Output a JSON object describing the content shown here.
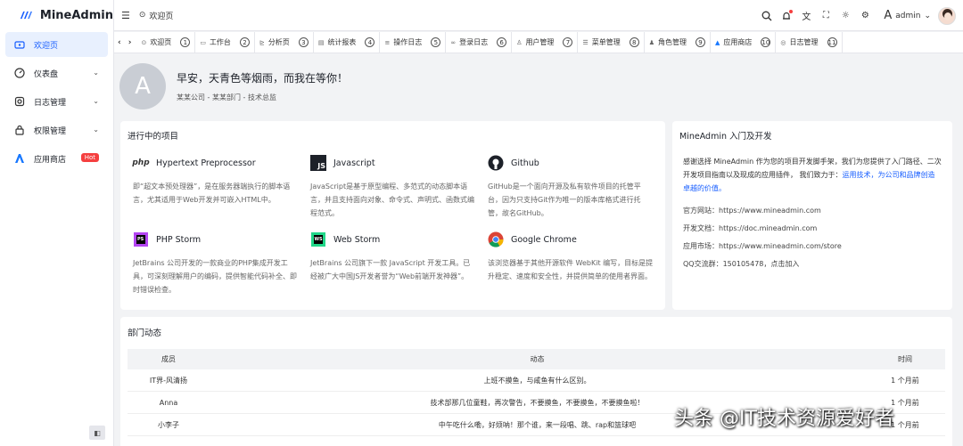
{
  "app": {
    "name": "MineAdmin"
  },
  "sidebar": {
    "items": [
      {
        "label": "欢迎页",
        "active": true
      },
      {
        "label": "仪表盘"
      },
      {
        "label": "日志管理"
      },
      {
        "label": "权限管理"
      },
      {
        "label": "应用商店",
        "badge": "Hot"
      }
    ]
  },
  "header": {
    "breadcrumb": "欢迎页",
    "username": "admin",
    "avatar_letter": "A"
  },
  "tabs": [
    {
      "label": "欢迎页",
      "num": "1"
    },
    {
      "label": "工作台",
      "num": "2"
    },
    {
      "label": "分析页",
      "num": "3"
    },
    {
      "label": "统计报表",
      "num": "4"
    },
    {
      "label": "操作日志",
      "num": "5"
    },
    {
      "label": "登录日志",
      "num": "6"
    },
    {
      "label": "用户管理",
      "num": "7"
    },
    {
      "label": "菜单管理",
      "num": "8"
    },
    {
      "label": "角色管理",
      "num": "9"
    },
    {
      "label": "应用商店",
      "num": "10"
    },
    {
      "label": "日志管理",
      "num": "11"
    }
  ],
  "welcome": {
    "avatar_letter": "A",
    "greeting": "早安，天青色等烟雨，而我在等你！",
    "subtitle": "某某公司 - 某某部门 - 技术总监"
  },
  "projects": {
    "title": "进行中的项目",
    "items": [
      {
        "name": "Hypertext Preprocessor",
        "logo": "php",
        "desc": "即“超文本预处理器”，是在服务器端执行的脚本语言，尤其适用于Web开发并可嵌入HTML中。"
      },
      {
        "name": "Javascript",
        "logo": "JS",
        "desc": "JavaScript是基于原型编程、多范式的动态脚本语言，并且支持面向对象、命令式、声明式、函数式编程范式。"
      },
      {
        "name": "Github",
        "logo": "github",
        "desc": "GitHub是一个面向开源及私有软件项目的托管平台，因为只支持Git作为唯一的版本库格式进行托管，故名GitHub。"
      },
      {
        "name": "PHP Storm",
        "logo": "PS",
        "desc": "JetBrains 公司开发的一款商业的PHP集成开发工具，可深刻理解用户的编码，提供智能代码补全、即时错误检查。"
      },
      {
        "name": "Web Storm",
        "logo": "WS",
        "desc": "JetBrains 公司旗下一款 JavaScript 开发工具。已经被广大中国JS开发者誉为“Web前端开发神器”。"
      },
      {
        "name": "Google Chrome",
        "logo": "chrome",
        "desc": "该浏览器基于其他开源软件 WebKit 编写，目标是提升稳定、速度和安全性，并提供简单的使用者界面。"
      }
    ]
  },
  "intro": {
    "title": "MineAdmin 入门及开发",
    "text": "感谢选择 MineAdmin 作为您的项目开发脚手架，我们为您提供了入门路径、二次开发项目指南以及现成的应用插件， 我们致力于：",
    "link_text": "运用技术，为公司和品牌创造卓越的价值。",
    "lines": [
      "官方网站：https://www.mineadmin.com",
      "开发文档：https://doc.mineadmin.com",
      "应用市场：https://www.mineadmin.com/store",
      "QQ交流群：150105478，点击加入"
    ]
  },
  "department": {
    "title": "部门动态",
    "columns": [
      "成员",
      "动态",
      "时间"
    ],
    "rows": [
      [
        "IT界-风清扬",
        "上班不摸鱼，与咸鱼有什么区别。",
        "1 个月前"
      ],
      [
        "Anna",
        "技术部那几位童鞋，再次警告，不要摸鱼，不要摸鱼，不要摸鱼啦！",
        "1 个月前"
      ],
      [
        "小李子",
        "中午吃什么嘞，好烦呐！那个谁，来一段唱、跳、rap和篮球吧",
        "1 个月前"
      ]
    ]
  },
  "watermark": "头条 @IT技术资源爱好者"
}
